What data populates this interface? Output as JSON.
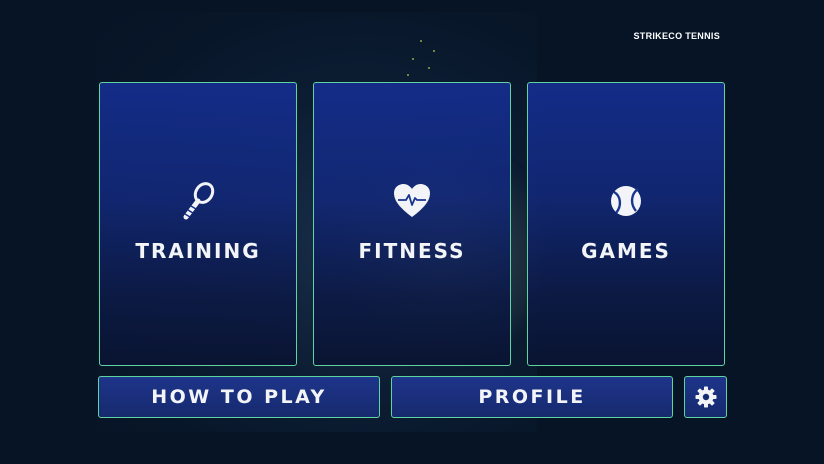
{
  "app": {
    "brand": "STRIKECO TENNIS"
  },
  "menu": {
    "cards": [
      {
        "label": "TRAINING",
        "icon": "tennis-racket-icon"
      },
      {
        "label": "FITNESS",
        "icon": "heart-pulse-icon"
      },
      {
        "label": "GAMES",
        "icon": "tennis-ball-icon"
      }
    ],
    "buttons": {
      "how_to_play": "HOW TO PLAY",
      "profile": "PROFILE",
      "settings_icon": "gear-icon"
    }
  },
  "colors": {
    "background": "#071426",
    "card_border": "#5fd3a0",
    "card_top": "#142d8c",
    "text": "#f2f4f8",
    "accent_sparkle": "#a6d34a"
  }
}
